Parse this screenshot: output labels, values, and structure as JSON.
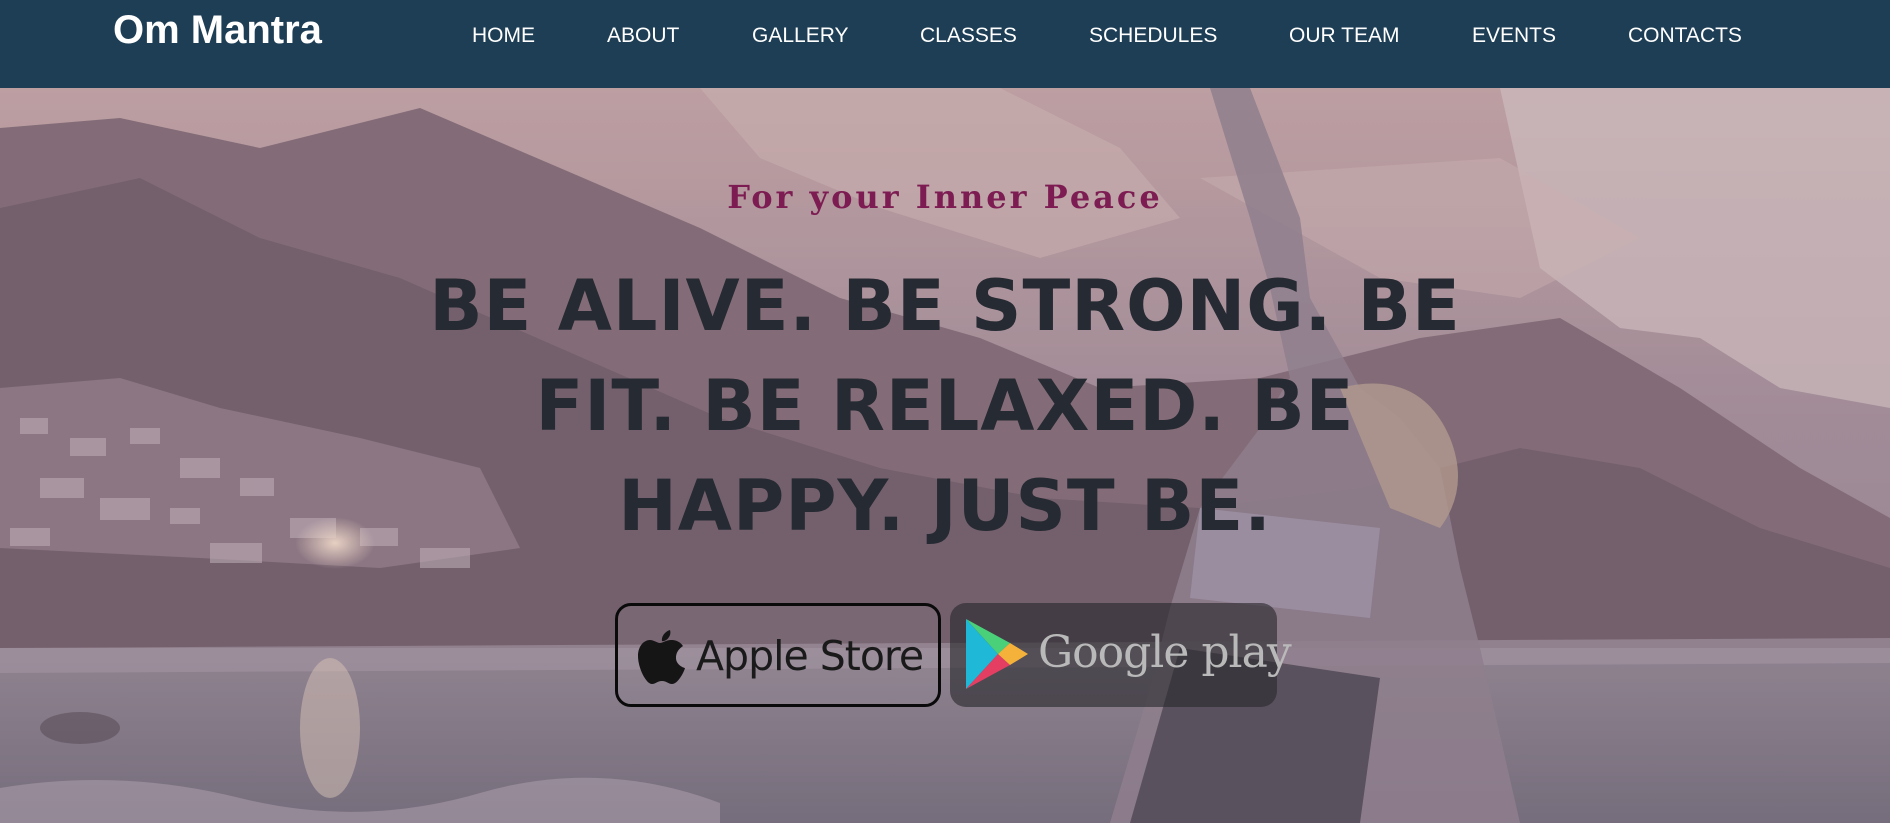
{
  "brand": {
    "name": "Om Mantra"
  },
  "nav": {
    "items": [
      {
        "label": "HOME"
      },
      {
        "label": "ABOUT"
      },
      {
        "label": "GALLERY"
      },
      {
        "label": "CLASSES"
      },
      {
        "label": "SCHEDULES"
      },
      {
        "label": "OUR TEAM"
      },
      {
        "label": "EVENTS"
      },
      {
        "label": "CONTACTS"
      }
    ]
  },
  "hero": {
    "tagline": "For your Inner Peace",
    "headline": "BE ALIVE. BE STRONG. BE FIT. BE RELAXED. BE HAPPY. JUST BE.",
    "buttons": {
      "apple_label": "Apple Store",
      "google_label": "Google play"
    }
  },
  "colors": {
    "navbar": "#1e3e55",
    "nav_text": "#ffffff",
    "tagline": "#7d1c52",
    "headline": "#262a33"
  },
  "icons": {
    "apple": "apple-logo-icon",
    "google_play": "google-play-icon"
  }
}
